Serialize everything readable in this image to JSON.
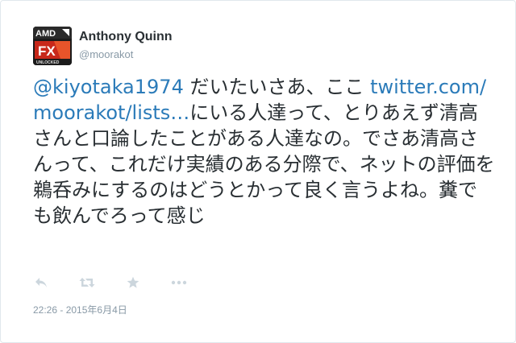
{
  "tweet": {
    "author": {
      "name": "Anthony Quinn",
      "handle": "@moorakot",
      "avatar_badge": "AMD",
      "avatar_product": "FX",
      "avatar_caption": "UNLOCKED"
    },
    "text": {
      "mention": "@kiyotaka1974",
      "part1": " だいたいさあ、ここ ",
      "link": "twitter.com/moorakot/lists…",
      "part2": "にいる人達って、とりあえず清高さんと口論したことがある人達なの。でさあ清高さんって、これだけ実績のある分際で、ネットの評価を鵜呑みにするのはどうとかって良く言うよね。糞でも飲んでろって感じ"
    },
    "actions": [
      {
        "name": "reply",
        "icon": "reply-icon"
      },
      {
        "name": "retweet",
        "icon": "retweet-icon"
      },
      {
        "name": "favorite",
        "icon": "star-icon"
      },
      {
        "name": "more",
        "icon": "more-icon"
      }
    ],
    "timestamp": "22:26 - 2015年6月4日"
  },
  "colors": {
    "text": "#292f33",
    "link": "#2b7bb9",
    "muted": "#8899a6",
    "icon": "#ccd6dd",
    "border": "#e1e8ed",
    "avatar_accent": "#e03a1e"
  }
}
